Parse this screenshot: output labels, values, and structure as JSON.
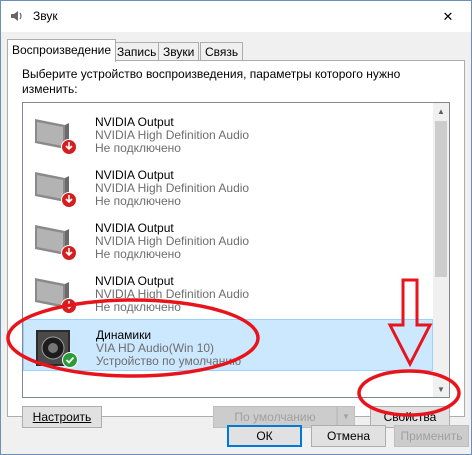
{
  "window": {
    "title": "Звук",
    "close_symbol": "✕"
  },
  "tabs": [
    {
      "label": "Воспроизведение",
      "active": true
    },
    {
      "label": "Запись",
      "active": false
    },
    {
      "label": "Звуки",
      "active": false
    },
    {
      "label": "Связь",
      "active": false
    }
  ],
  "panel": {
    "prompt": "Выберите устройство воспроизведения, параметры которого нужно изменить:"
  },
  "devices": [
    {
      "name": "NVIDIA Output",
      "driver": "NVIDIA High Definition Audio",
      "status": "Не подключено",
      "icon": "monitor-disconnected-icon",
      "selected": false
    },
    {
      "name": "NVIDIA Output",
      "driver": "NVIDIA High Definition Audio",
      "status": "Не подключено",
      "icon": "monitor-disconnected-icon",
      "selected": false
    },
    {
      "name": "NVIDIA Output",
      "driver": "NVIDIA High Definition Audio",
      "status": "Не подключено",
      "icon": "monitor-disconnected-icon",
      "selected": false
    },
    {
      "name": "NVIDIA Output",
      "driver": "NVIDIA High Definition Audio",
      "status": "Не подключено",
      "icon": "monitor-disconnected-icon",
      "selected": false
    },
    {
      "name": "Динамики",
      "driver": "VIA HD Audio(Win 10)",
      "status": "Устройство по умолчанию",
      "icon": "speaker-default-icon",
      "selected": true
    }
  ],
  "buttons": {
    "configure": "Настроить",
    "set_default": "По умолчанию",
    "properties": "Свойства",
    "ok": "ОК",
    "cancel": "Отмена",
    "apply": "Применить"
  },
  "colors": {
    "selection": "#cce8ff",
    "annotation_red": "#e8141c",
    "default_check": "#2a9d3a",
    "disconnected_red": "#d21f1f"
  }
}
